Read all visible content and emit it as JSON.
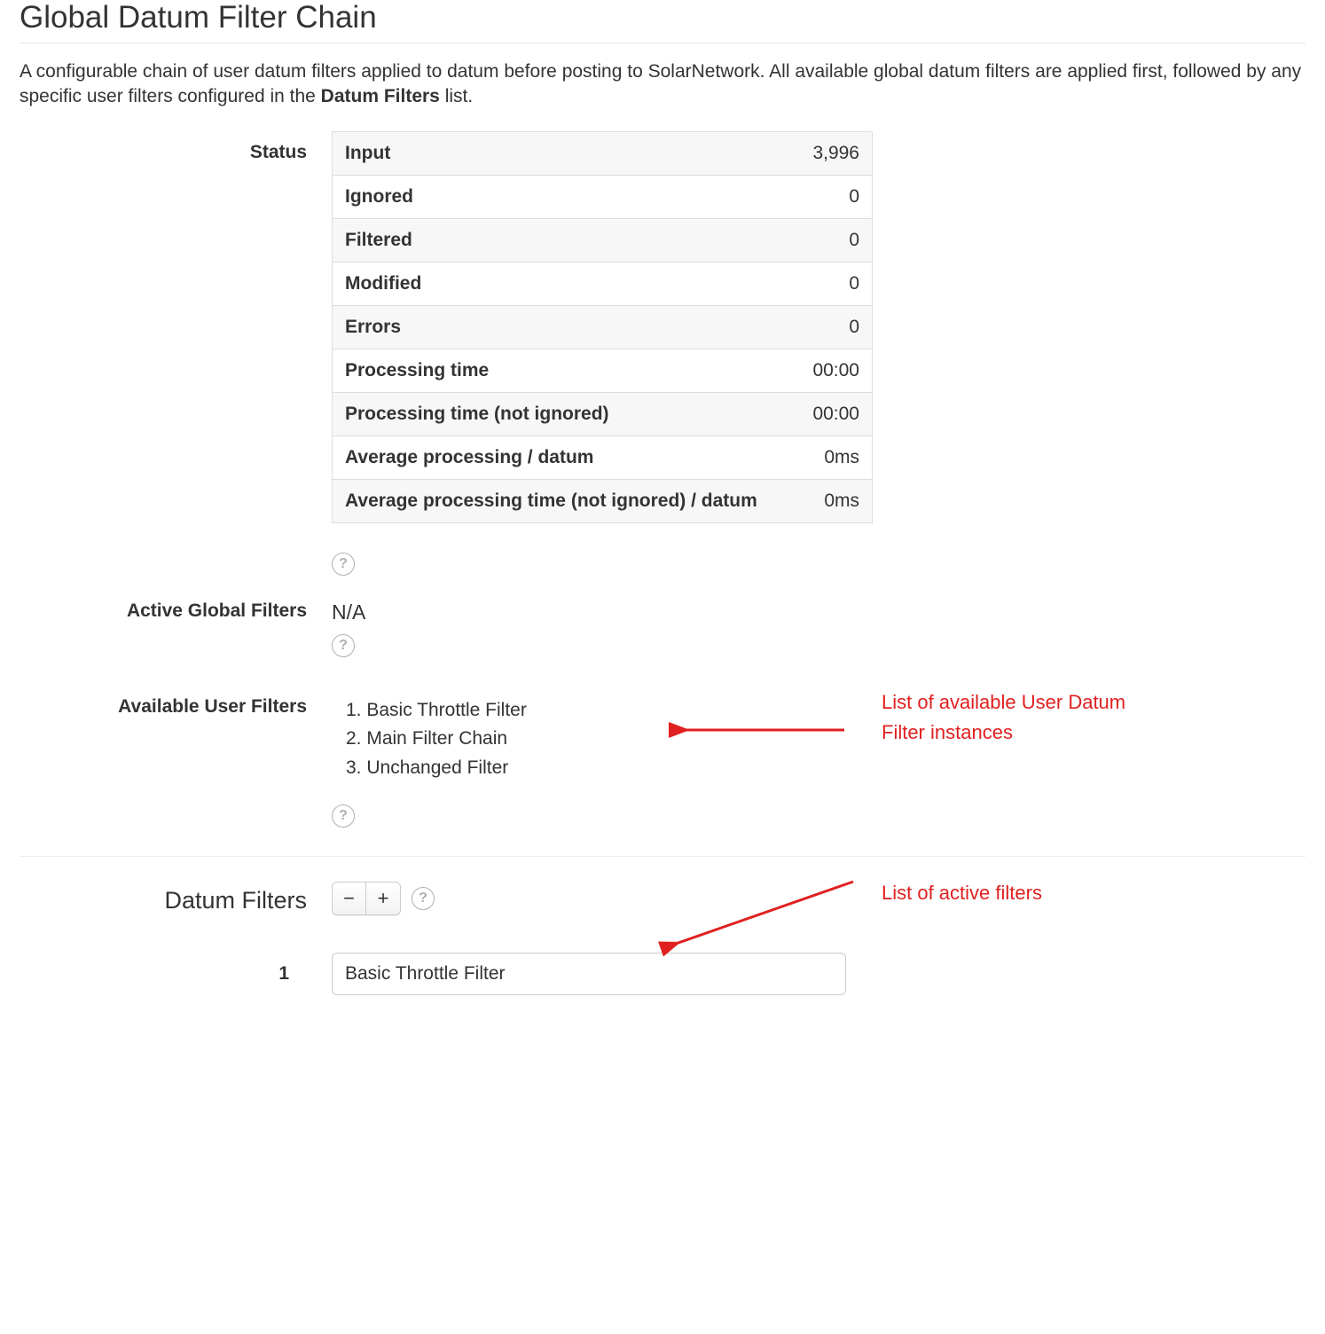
{
  "page": {
    "title": "Global Datum Filter Chain",
    "description_pre": "A configurable chain of user datum filters applied to datum before posting to SolarNetwork. All available global datum filters are applied first, followed by any specific user filters configured in the ",
    "description_bold": "Datum Filters",
    "description_post": " list."
  },
  "labels": {
    "status": "Status",
    "active_global_filters": "Active Global Filters",
    "available_user_filters": "Available User Filters",
    "datum_filters": "Datum Filters"
  },
  "status_rows": [
    {
      "label": "Input",
      "value": "3,996"
    },
    {
      "label": "Ignored",
      "value": "0"
    },
    {
      "label": "Filtered",
      "value": "0"
    },
    {
      "label": "Modified",
      "value": "0"
    },
    {
      "label": "Errors",
      "value": "0"
    },
    {
      "label": "Processing time",
      "value": "00:00"
    },
    {
      "label": "Processing time (not ignored)",
      "value": "00:00"
    },
    {
      "label": "Average processing / datum",
      "value": "0ms"
    },
    {
      "label": "Average processing time (not ignored) / datum",
      "value": "0ms"
    }
  ],
  "active_global_filters_value": "N/A",
  "available_user_filters": [
    "Basic Throttle Filter",
    "Main Filter Chain",
    "Unchanged Filter"
  ],
  "datum_filters": [
    {
      "index": "1",
      "value": "Basic Throttle Filter"
    }
  ],
  "buttons": {
    "minus": "−",
    "plus": "+",
    "help": "?"
  },
  "annotations": {
    "available_list": "List of available User Datum Filter instances",
    "active_list": "List of active filters"
  }
}
